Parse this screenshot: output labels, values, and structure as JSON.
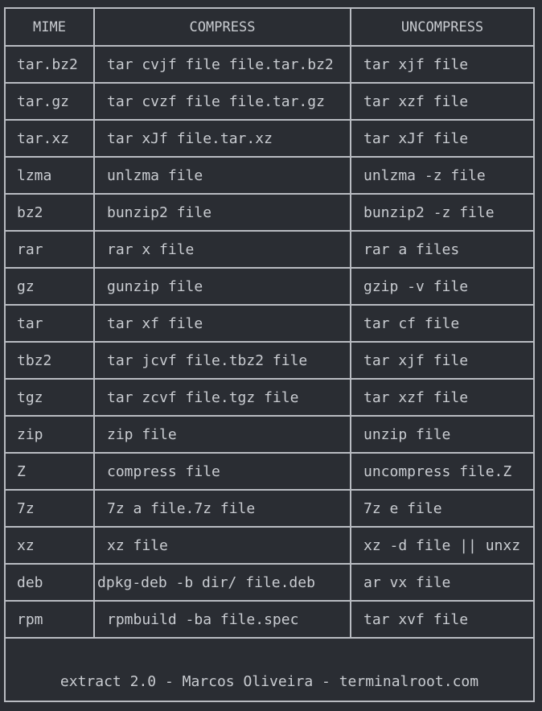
{
  "table": {
    "headers": [
      "MIME",
      "COMPRESS",
      "UNCOMPRESS"
    ],
    "rows": [
      [
        "tar.bz2",
        "tar cvjf file file.tar.bz2",
        "tar xjf file"
      ],
      [
        "tar.gz",
        "tar cvzf file file.tar.gz",
        "tar xzf file"
      ],
      [
        "tar.xz",
        "tar xJf file.tar.xz",
        "tar xJf file"
      ],
      [
        "lzma",
        "unlzma  file",
        "unlzma -z file"
      ],
      [
        "bz2",
        "bunzip2 file",
        "bunzip2 -z file"
      ],
      [
        "rar",
        "rar x file",
        "rar a files"
      ],
      [
        "gz",
        "gunzip file",
        "gzip -v file"
      ],
      [
        "tar",
        "tar xf file",
        "tar cf file"
      ],
      [
        "tbz2",
        "tar jcvf file.tbz2 file",
        "tar xjf file"
      ],
      [
        "tgz",
        "tar zcvf file.tgz file",
        "tar xzf file"
      ],
      [
        "zip",
        "zip file",
        "unzip file"
      ],
      [
        "Z",
        "compress file",
        "uncompress file.Z"
      ],
      [
        "7z",
        "7z a file.7z file",
        "7z e file"
      ],
      [
        "xz",
        "xz file",
        "xz -d file || unxz"
      ],
      [
        "deb",
        "dpkg-deb -b dir/ file.deb",
        "ar vx file"
      ],
      [
        "rpm",
        "rpmbuild -ba file.spec",
        "tar xvf file"
      ]
    ]
  },
  "footer": {
    "text": "extract 2.0 - Marcos Oliveira - terminalroot.com"
  },
  "colors": {
    "background": "#2a2d33",
    "border": "#b9bcc2",
    "text": "#c9ccd1"
  }
}
